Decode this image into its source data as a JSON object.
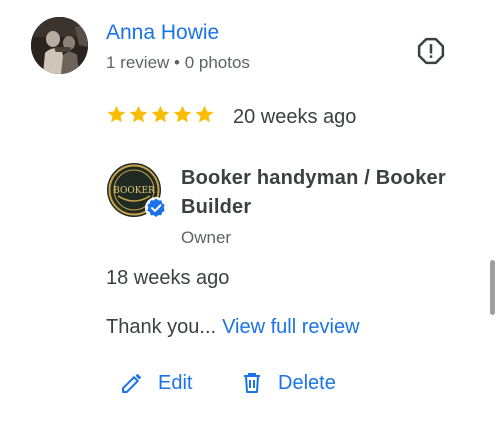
{
  "reviewer": {
    "name": "Anna Howie",
    "meta": "1 review • 0 photos"
  },
  "review": {
    "rating": 5,
    "max_rating": 5,
    "time": "20 weeks ago",
    "star_color": "#fbbc04"
  },
  "owner_response": {
    "name": "Booker handyman / Booker Builder",
    "role": "Owner",
    "logo_text": "BOOKER",
    "time": "18 weeks ago",
    "text": "Thank you...",
    "view_full_label": "View full review"
  },
  "actions": {
    "edit_label": "Edit",
    "delete_label": "Delete"
  },
  "icons": {
    "report": "report-icon",
    "edit": "pencil-icon",
    "delete": "trash-icon",
    "verified": "verified-badge-icon"
  },
  "colors": {
    "accent": "#1a73e8",
    "text": "#3c4043",
    "secondary_text": "#5f6368"
  }
}
